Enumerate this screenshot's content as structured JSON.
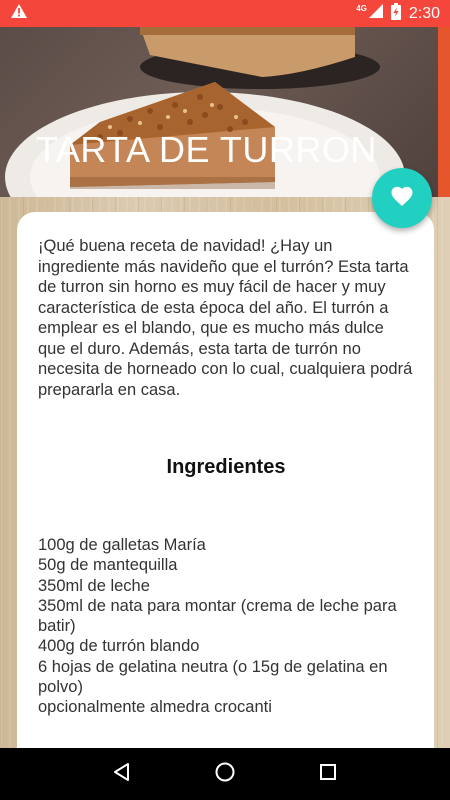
{
  "status_bar": {
    "time": "2:30",
    "network": "4G",
    "icons": [
      "warning-icon",
      "signal-icon",
      "battery-charging-icon"
    ]
  },
  "hero": {
    "title": "TARTA DE TURRON",
    "image": "cake-slice-photo"
  },
  "fab": {
    "icon": "heart-icon",
    "accent": "#21d0c0"
  },
  "recipe": {
    "intro": "¡Qué buena receta de navidad! ¿Hay un ingrediente más navideño que el turrón? Esta tarta de turron sin horno es muy fácil de hacer y muy característica de esta época del año. El turrón a emplear es el blando, que es mucho más dulce que el duro. Además, esta tarta de turrón no necesita de horneado con lo cual, cualquiera podrá prepararla en casa.",
    "ingredients_title": "Ingredientes",
    "ingredients": [
      "100g de galletas María",
      "50g de mantequilla",
      "350ml de leche",
      "350ml de nata para montar (crema de leche para batir)",
      "400g de turrón blando",
      "6 hojas de gelatina neutra (o 15g de gelatina en polvo)",
      "opcionalmente almedra crocanti"
    ]
  },
  "nav_bar": {
    "buttons": [
      "back-icon",
      "home-icon",
      "recents-icon"
    ]
  },
  "colors": {
    "status_bar": "#f4463a",
    "fab": "#21d0c0",
    "nav_bar": "#000000"
  }
}
